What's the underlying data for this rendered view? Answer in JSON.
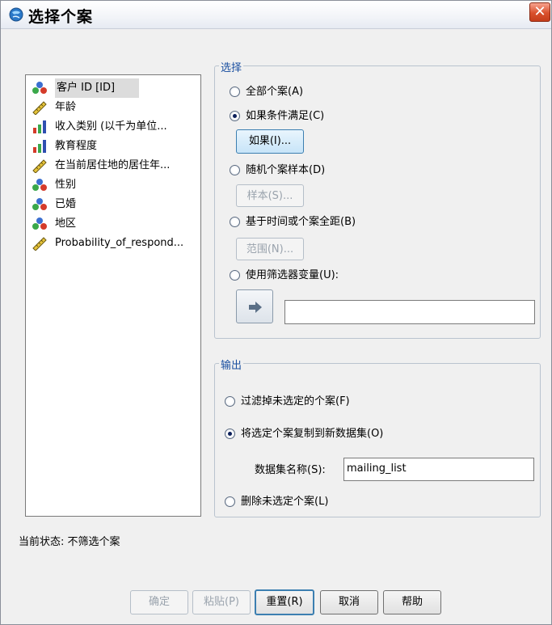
{
  "window": {
    "title": "选择个案",
    "close_icon": "close-icon",
    "app_icon": "spss-globe-icon"
  },
  "variables": [
    {
      "label": "客户 ID [ID]",
      "icon": "nominal-icon",
      "selected": true
    },
    {
      "label": "年龄",
      "icon": "scale-ruler-icon"
    },
    {
      "label": "收入类别 (以千为单位...",
      "icon": "ordinal-bar-icon"
    },
    {
      "label": "教育程度",
      "icon": "ordinal-bar-icon"
    },
    {
      "label": "在当前居住地的居住年...",
      "icon": "scale-ruler-icon"
    },
    {
      "label": "性别",
      "icon": "nominal-icon"
    },
    {
      "label": "已婚",
      "icon": "nominal-icon"
    },
    {
      "label": "地区",
      "icon": "nominal-icon"
    },
    {
      "label": "Probability_of_respond...",
      "icon": "scale-ruler-icon"
    }
  ],
  "select": {
    "title": "选择",
    "all_cases": "全部个案(A)",
    "if_condition": "如果条件满足(C)",
    "if_button": "如果(I)...",
    "random_sample": "随机个案样本(D)",
    "sample_button": "样本(S)...",
    "range": "基于时间或个案全距(B)",
    "range_button": "范围(N)...",
    "filter_variable": "使用筛选器变量(U):",
    "filter_value": "",
    "selected_option": "if_condition"
  },
  "output": {
    "title": "输出",
    "filter_out": "过滤掉未选定的个案(F)",
    "copy_new": "将选定个案复制到新数据集(O)",
    "dataset_name_label": "数据集名称(S):",
    "dataset_name_value": "mailing_list",
    "delete": "删除未选定个案(L)",
    "selected_option": "copy_new"
  },
  "status": {
    "text": "当前状态: 不筛选个案"
  },
  "buttons": {
    "ok": "确定",
    "paste": "粘贴(P)",
    "reset": "重置(R)",
    "cancel": "取消",
    "help": "帮助"
  },
  "colors": {
    "group_title": "#1a4fa0",
    "window_bg": "#f0f0f0",
    "close_button": "#d9502c",
    "nominal_blue": "#3b6fd0",
    "nominal_red": "#d43b2a",
    "nominal_green": "#3aa84a",
    "ruler_yellow": "#e7c43a"
  }
}
